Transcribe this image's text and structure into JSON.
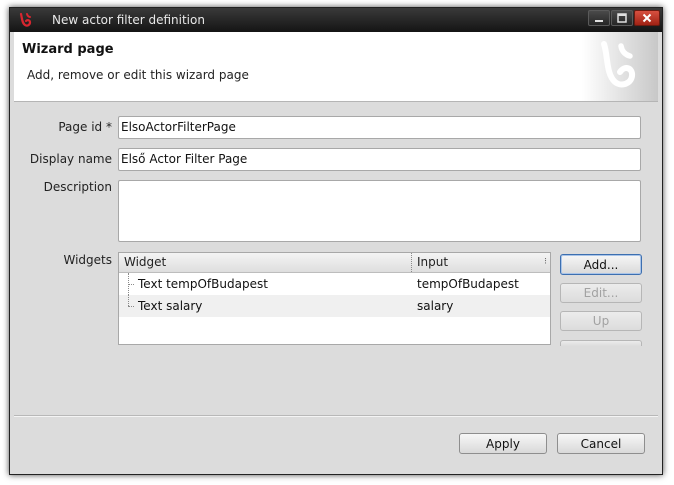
{
  "window": {
    "title": "New actor filter definition",
    "controls": {
      "minimize": "minimize",
      "maximize": "maximize",
      "close": "close"
    }
  },
  "header": {
    "title": "Wizard page",
    "description": "Add, remove or edit this wizard page"
  },
  "form": {
    "page_id": {
      "label": "Page id *",
      "value": "ElsoActorFilterPage"
    },
    "display_name": {
      "label": "Display name",
      "value": "Első Actor Filter Page"
    },
    "description": {
      "label": "Description",
      "value": ""
    },
    "widgets_label": "Widgets"
  },
  "widgets_table": {
    "columns": [
      "Widget",
      "Input"
    ],
    "rows": [
      {
        "widget": "Text tempOfBudapest",
        "input": "tempOfBudapest"
      },
      {
        "widget": "Text salary",
        "input": "salary"
      }
    ]
  },
  "side_buttons": {
    "add": "Add...",
    "edit": "Edit...",
    "up": "Up"
  },
  "footer": {
    "apply": "Apply",
    "cancel": "Cancel"
  },
  "colors": {
    "accent": "#3d6fb0",
    "titlebar": "#1e1e1e",
    "logo_red": "#d8262f"
  }
}
